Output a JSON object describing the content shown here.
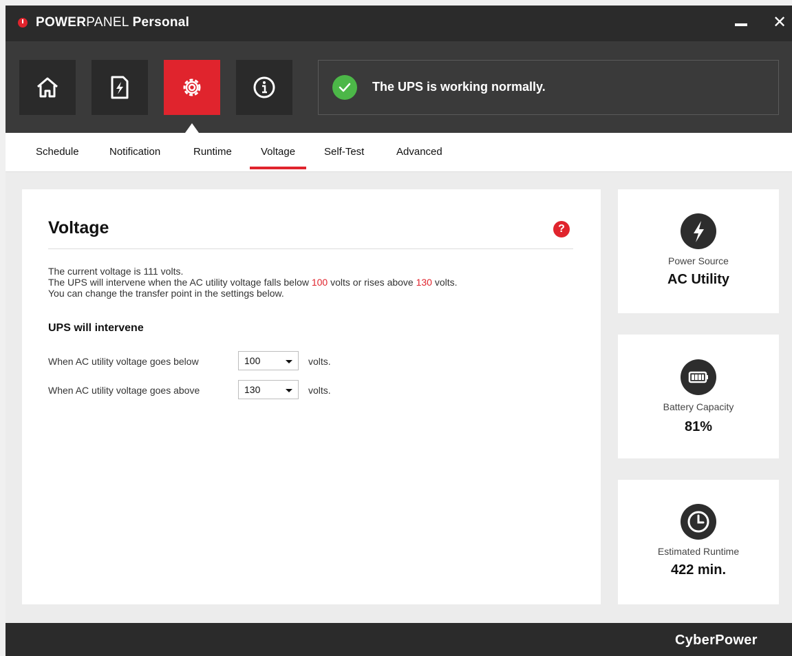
{
  "app": {
    "title_bold": "POWER",
    "title_light": "PANEL",
    "title_suffix": "Personal",
    "minimize_icon": "minimize-icon",
    "close_label": "✕"
  },
  "nav": {
    "buttons": [
      {
        "name": "home",
        "icon": "home-icon",
        "active": false
      },
      {
        "name": "status-report",
        "icon": "power-document-icon",
        "active": false
      },
      {
        "name": "settings",
        "icon": "gear-icon",
        "active": true
      },
      {
        "name": "information",
        "icon": "info-icon",
        "active": false
      }
    ],
    "status": {
      "icon": "check-circle-icon",
      "text": "The UPS is working normally."
    }
  },
  "subtabs": [
    {
      "label": "Schedule",
      "active": false
    },
    {
      "label": "Notification",
      "active": false
    },
    {
      "label": "Runtime",
      "active": false
    },
    {
      "label": "Voltage",
      "active": true
    },
    {
      "label": "Self-Test",
      "active": false
    },
    {
      "label": "Advanced",
      "active": false
    }
  ],
  "main": {
    "title": "Voltage",
    "help_label": "?",
    "desc": {
      "line1": "The current voltage is 111 volts.",
      "line2_pre": "The UPS will intervene when the AC utility voltage falls below ",
      "line2_low": "100",
      "line2_mid": " volts or rises above ",
      "line2_high": "130",
      "line2_post": " volts.",
      "line3": "You can change the transfer point in the settings below."
    },
    "section_title": "UPS will intervene",
    "rows": [
      {
        "label": "When AC utility voltage goes below",
        "value": "100",
        "unit": "volts."
      },
      {
        "label": "When AC utility voltage goes above",
        "value": "130",
        "unit": "volts."
      }
    ]
  },
  "cards": [
    {
      "icon": "lightning-icon",
      "label": "Power Source",
      "value": "AC Utility"
    },
    {
      "icon": "battery-icon",
      "label": "Battery Capacity",
      "value": "81%"
    },
    {
      "icon": "clock-icon",
      "label": "Estimated Runtime",
      "value": "422 min."
    }
  ],
  "footer": {
    "brand": "CyberPower"
  },
  "colors": {
    "accent": "#e0242d",
    "ok": "#4cb748",
    "header_bg": "#2b2b2b"
  }
}
